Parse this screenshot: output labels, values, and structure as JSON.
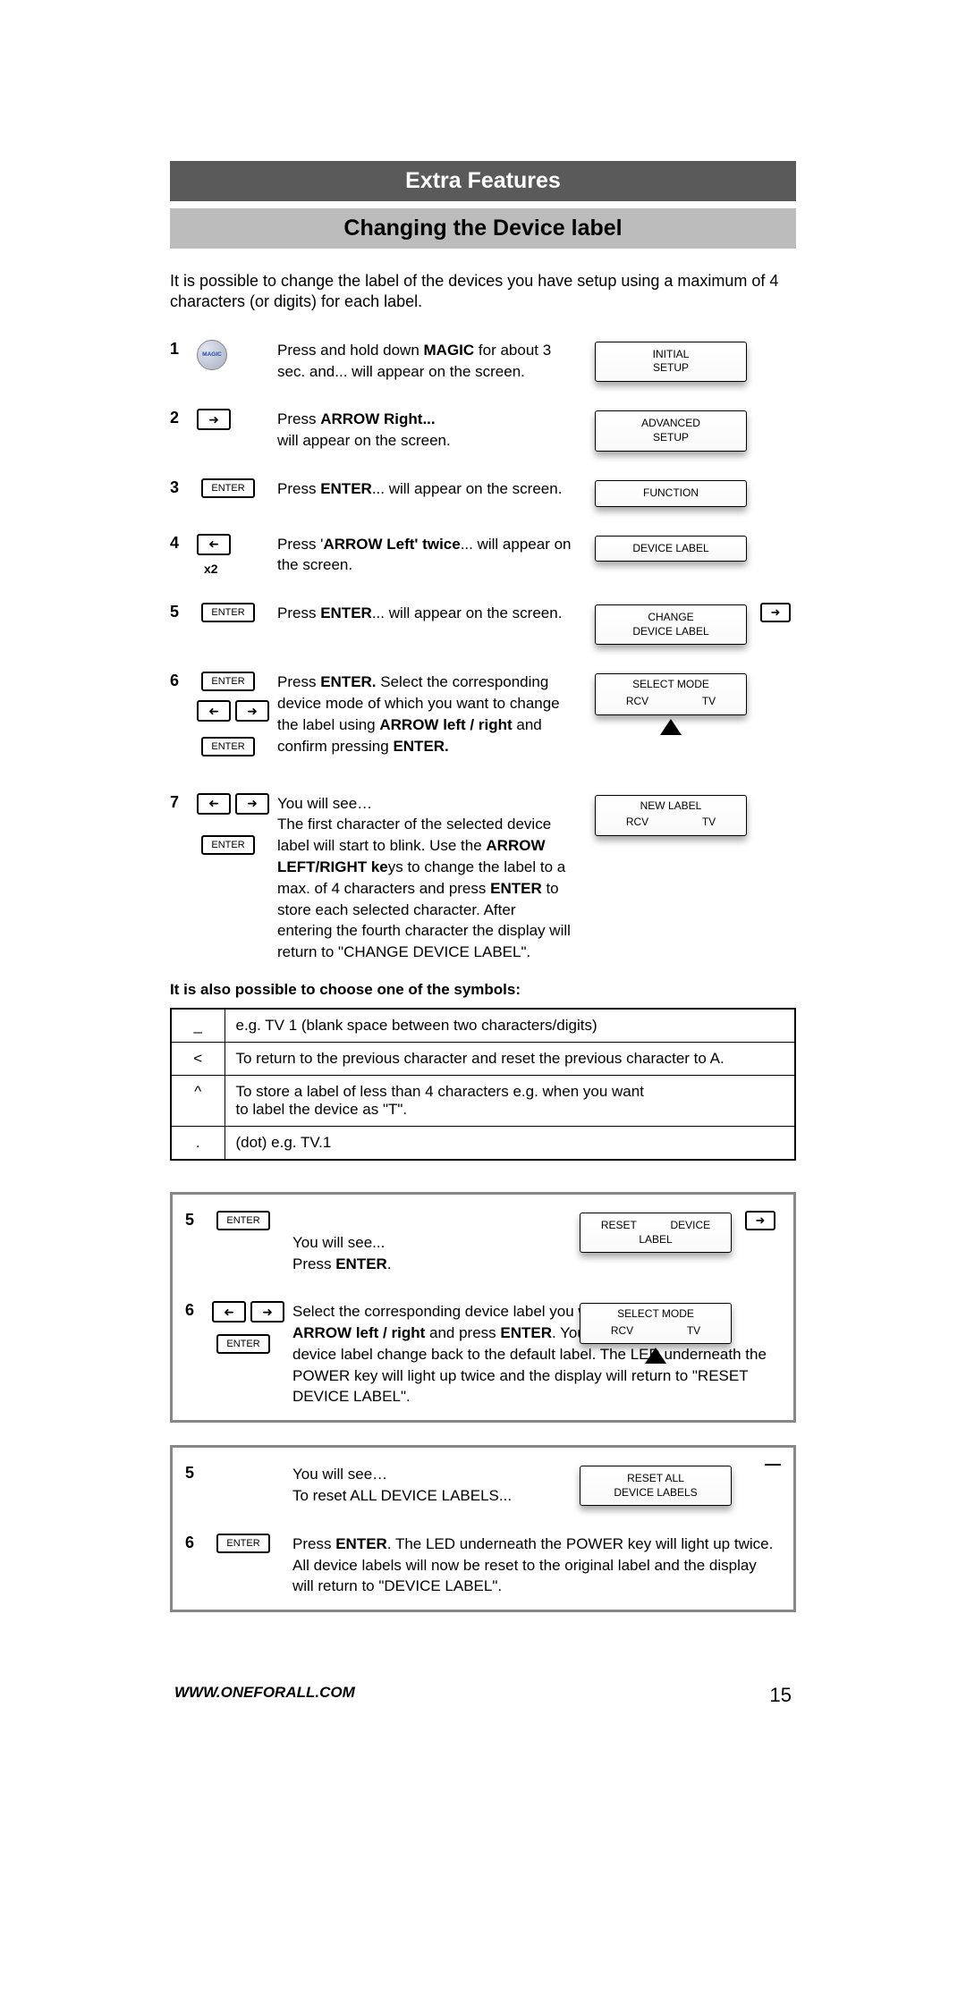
{
  "header": {
    "title_dark": "Extra Features",
    "title_light": "Changing the Device label"
  },
  "intro": "It is possible to change the label of the devices you have setup using a maximum of 4 characters (or digits) for each label.",
  "steps": [
    {
      "num": "1",
      "icon": "magic",
      "text_pre": "Press and hold down ",
      "text_bold": "MAGIC",
      "text_post": " for about 3 sec. and... will appear on the screen.",
      "screen_line1": "INITIAL",
      "screen_line2": "SETUP"
    },
    {
      "num": "2",
      "icon": "arrow-right",
      "text_pre": "Press ",
      "text_bold": "ARROW Right...",
      "text_post": " will appear on the screen.",
      "screen_line1": "ADVANCED",
      "screen_line2": "SETUP"
    },
    {
      "num": "3",
      "icon": "enter",
      "text_pre": "Press ",
      "text_bold": "ENTER",
      "text_post": "... will appear on the screen.",
      "screen_line1": "FUNCTION",
      "screen_line2": ""
    },
    {
      "num": "4",
      "icon": "arrow-left-x2",
      "text_pre": "Press '",
      "text_bold": "ARROW Left' twice",
      "text_post": "... will appear on the screen.",
      "screen_line1": "DEVICE LABEL",
      "screen_line2": ""
    },
    {
      "num": "5",
      "icon": "enter",
      "text_pre": "Press ",
      "text_bold": "ENTER",
      "text_post": "... will appear on the screen.",
      "screen_line1": "CHANGE",
      "screen_line2": "DEVICE LABEL",
      "has_out_arrow": true
    },
    {
      "num": "6",
      "icon": "enter-arrows-enter",
      "text_html_parts": [
        {
          "t": "Press ",
          "b": false
        },
        {
          "t": "ENTER.",
          "b": true
        },
        {
          "t": " Select the corresponding device mode of which you want to change the label using ",
          "b": false
        },
        {
          "t": "ARROW left / right",
          "b": true
        },
        {
          "t": " and confirm pressing ",
          "b": false
        },
        {
          "t": "ENTER.",
          "b": true
        }
      ],
      "screen_top": "SELECT MODE",
      "screen_col1": "RCV",
      "screen_col2": "TV",
      "triangle": true
    },
    {
      "num": "7",
      "icon": "arrows-enter",
      "text_html_parts": [
        {
          "t": "You will see…",
          "b": false
        },
        {
          "t": "\nThe first character of the selected device label will start to blink. Use the ",
          "b": false
        },
        {
          "t": "ARROW LEFT/RIGHT ke",
          "b": true
        },
        {
          "t": "ys to change the label to a max. of 4 characters and press ",
          "b": false
        },
        {
          "t": "ENTER",
          "b": true
        },
        {
          "t": " to store each selected character.  After entering the fourth character the display will return to \"CHANGE DEVICE LABEL\".",
          "b": false
        }
      ],
      "screen_top": "NEW LABEL",
      "screen_col1": "RCV",
      "screen_col2": "TV"
    }
  ],
  "symbols_heading": "It is also possible to choose one of the symbols:",
  "symbols": [
    {
      "sym": "_",
      "desc": "e.g.  TV 1 (blank space between two characters/digits)"
    },
    {
      "sym": "<",
      "desc": "To return to the previous character and reset the previous character to A."
    },
    {
      "sym": "^",
      "desc": "To store a label of less than 4 characters e.g. when you want\nto label the device as \"T\"."
    },
    {
      "sym": ".",
      "desc": "(dot) e.g.  TV.1"
    }
  ],
  "reset_box1": [
    {
      "num": "5",
      "icon": "enter",
      "text_pre": "You will see...\nPress ",
      "text_bold": "ENTER",
      "text_post": ".",
      "screen_col1": "RESET",
      "screen_col2": "DEVICE",
      "screen_line2": "LABEL",
      "has_out_arrow": true
    },
    {
      "num": "6",
      "icon": "arrows-enter",
      "text_html_parts": [
        {
          "t": "Select the corresponding device label you wish to reset by using ",
          "b": false
        },
        {
          "t": "ARROW  left / right",
          "b": true
        },
        {
          "t": " and press ",
          "b": false
        },
        {
          "t": "ENTER",
          "b": true
        },
        {
          "t": ". You will see the selected device label change back to the default label. The LED underneath the POWER key will light up twice and  the display will return to \"RESET DEVICE LABEL\".",
          "b": false
        }
      ],
      "screen_top": "SELECT MODE",
      "screen_col1": "RCV",
      "screen_col2": "TV",
      "triangle": true
    }
  ],
  "reset_box2": [
    {
      "num": "5",
      "icon": "none",
      "text": "You will see…\nTo reset ALL DEVICE LABELS...",
      "screen_line1": "RESET ALL",
      "screen_line2": "DEVICE LABELS"
    },
    {
      "num": "6",
      "icon": "enter",
      "text_html_parts": [
        {
          "t": "Press ",
          "b": false
        },
        {
          "t": "ENTER",
          "b": true
        },
        {
          "t": ". The LED underneath the POWER key will light up twice. All device labels will now be reset to the original label and the display will return to \"DEVICE LABEL\".",
          "b": false
        }
      ]
    }
  ],
  "icon_labels": {
    "magic": "MAGIC",
    "enter": "ENTER",
    "x2": "x2"
  },
  "footer": {
    "url": "WWW.ONEFORALL.COM",
    "page": "15"
  }
}
